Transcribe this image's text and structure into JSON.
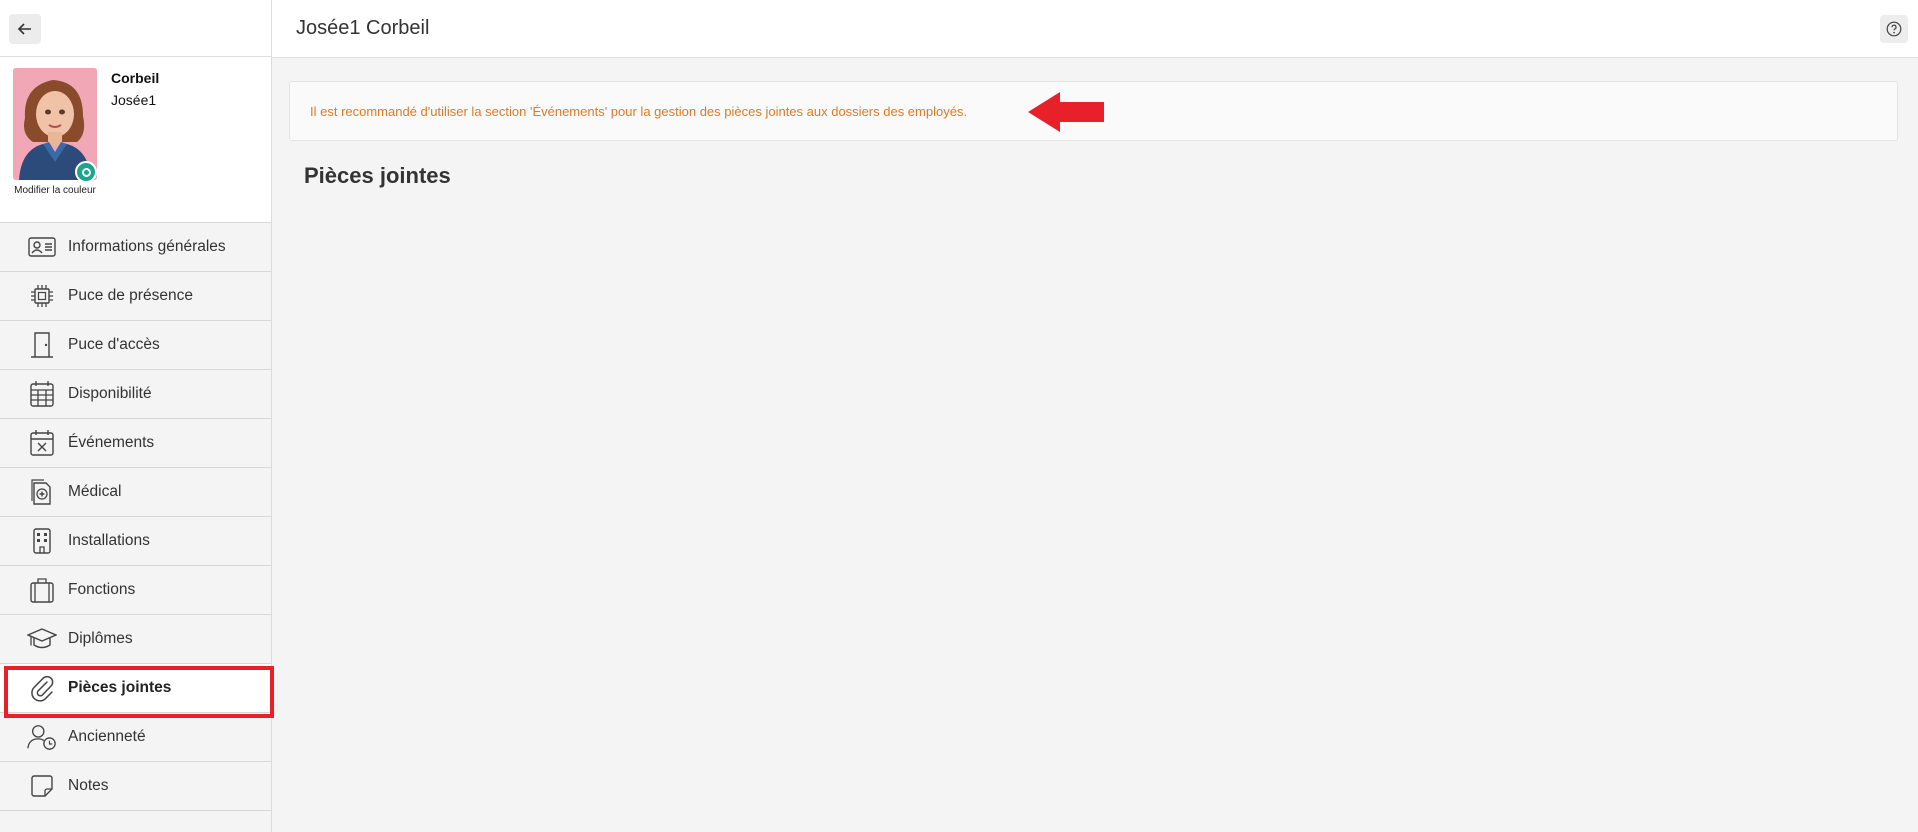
{
  "header": {
    "title": "Josée1 Corbeil"
  },
  "profile": {
    "last_name": "Corbeil",
    "first_name": "Josée1",
    "modify_color_label": "Modifier la couleur"
  },
  "sidebar": {
    "items": [
      {
        "label": "Informations générales",
        "icon": "id-card-icon"
      },
      {
        "label": "Puce de présence",
        "icon": "chip-icon"
      },
      {
        "label": "Puce d'accès",
        "icon": "door-icon"
      },
      {
        "label": "Disponibilité",
        "icon": "calendar-grid-icon"
      },
      {
        "label": "Événements",
        "icon": "calendar-x-icon"
      },
      {
        "label": "Médical",
        "icon": "medical-file-icon"
      },
      {
        "label": "Installations",
        "icon": "building-icon"
      },
      {
        "label": "Fonctions",
        "icon": "briefcase-icon"
      },
      {
        "label": "Diplômes",
        "icon": "graduation-cap-icon"
      },
      {
        "label": "Pièces jointes",
        "icon": "paperclip-icon",
        "active": true
      },
      {
        "label": "Ancienneté",
        "icon": "user-clock-icon"
      },
      {
        "label": "Notes",
        "icon": "note-icon"
      }
    ]
  },
  "notice": {
    "text": "Il est recommandé d'utiliser la section 'Événements' pour la gestion des pièces jointes aux dossiers des employés."
  },
  "main": {
    "section_title": "Pièces jointes"
  },
  "colors": {
    "notice_text": "#e07a22",
    "highlight": "#e8202a",
    "avatar_bg": "#f1a7b6",
    "camera_badge": "#1aa58c"
  }
}
